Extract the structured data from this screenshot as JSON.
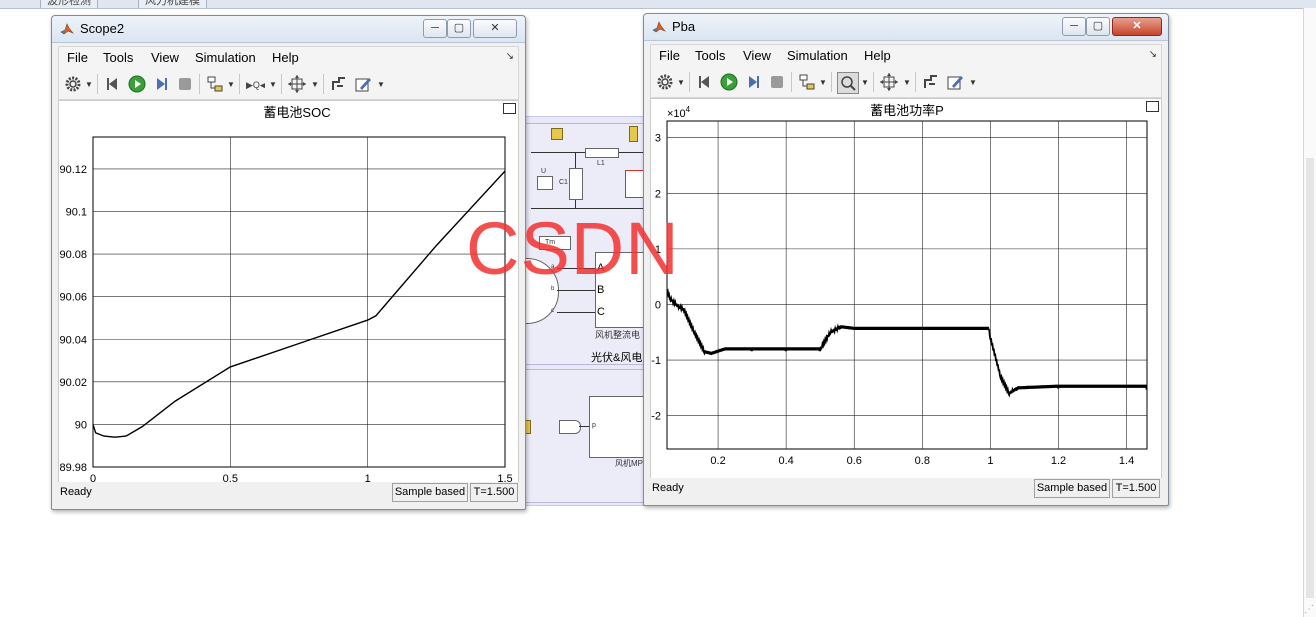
{
  "background": {
    "tabs": [
      "波形检测",
      "风力机建模"
    ],
    "accent": "#f23030"
  },
  "model": {
    "labels": [
      "L1",
      "U",
      "C1",
      "Tm",
      "A",
      "B",
      "C",
      "a",
      "b",
      "c",
      "风机整流电",
      "光伏&风电",
      "p",
      "风机MP"
    ]
  },
  "scope2": {
    "title": "Scope2",
    "menu": [
      "File",
      "Tools",
      "View",
      "Simulation",
      "Help"
    ],
    "status": {
      "ready": "Ready",
      "mode": "Sample based",
      "time": "T=1.500"
    },
    "chart_data": {
      "type": "line",
      "title": "蓄电池SOC",
      "xlabel": "",
      "ylabel": "",
      "xlim": [
        0,
        1.5
      ],
      "ylim": [
        89.98,
        90.135
      ],
      "xticks": [
        "0",
        "0.5",
        "1",
        "1.5"
      ],
      "xtick_values": [
        0,
        0.5,
        1,
        1.5
      ],
      "yticks": [
        "89.98",
        "90",
        "90.02",
        "90.04",
        "90.06",
        "90.08",
        "90.1",
        "90.12"
      ],
      "ytick_values": [
        89.98,
        90,
        90.02,
        90.04,
        90.06,
        90.08,
        90.1,
        90.12
      ],
      "grid": true,
      "line_color": "#000000",
      "x": [
        0,
        0.01,
        0.04,
        0.08,
        0.12,
        0.18,
        0.3,
        0.5,
        0.75,
        1.0,
        1.03,
        1.25,
        1.5
      ],
      "y": [
        90.0,
        89.996,
        89.9945,
        89.994,
        89.9945,
        89.999,
        90.011,
        90.027,
        90.038,
        90.049,
        90.051,
        90.084,
        90.119
      ]
    }
  },
  "pba": {
    "title": "Pba",
    "menu": [
      "File",
      "Tools",
      "View",
      "Simulation",
      "Help"
    ],
    "status": {
      "ready": "Ready",
      "mode": "Sample based",
      "time": "T=1.500"
    },
    "chart_data": {
      "type": "line",
      "title": "蓄电池功率P",
      "xlabel": "",
      "ylabel": "",
      "exponent_label": "×10",
      "exponent": "4",
      "xlim": [
        0.05,
        1.46
      ],
      "ylim": [
        -2.6,
        3.3
      ],
      "xticks": [
        "0.2",
        "0.4",
        "0.6",
        "0.8",
        "1",
        "1.2",
        "1.4"
      ],
      "xtick_values": [
        0.2,
        0.4,
        0.6,
        0.8,
        1.0,
        1.2,
        1.4
      ],
      "yticks": [
        "-2",
        "-1",
        "0",
        "1",
        "2",
        "3"
      ],
      "ytick_values": [
        -2,
        -1,
        0,
        1,
        2,
        3
      ],
      "grid": true,
      "line_color": "#000000",
      "x": [
        0.05,
        0.06,
        0.08,
        0.1,
        0.13,
        0.16,
        0.18,
        0.22,
        0.3,
        0.4,
        0.5,
        0.505,
        0.53,
        0.56,
        0.6,
        0.8,
        0.995,
        1.0,
        1.03,
        1.055,
        1.08,
        1.2,
        1.46
      ],
      "y": [
        0.25,
        0.1,
        -0.02,
        -0.1,
        -0.5,
        -0.85,
        -0.88,
        -0.8,
        -0.8,
        -0.8,
        -0.8,
        -0.75,
        -0.5,
        -0.4,
        -0.43,
        -0.43,
        -0.43,
        -0.6,
        -1.3,
        -1.6,
        -1.5,
        -1.47,
        -1.47
      ]
    }
  },
  "watermark": "CSDN"
}
